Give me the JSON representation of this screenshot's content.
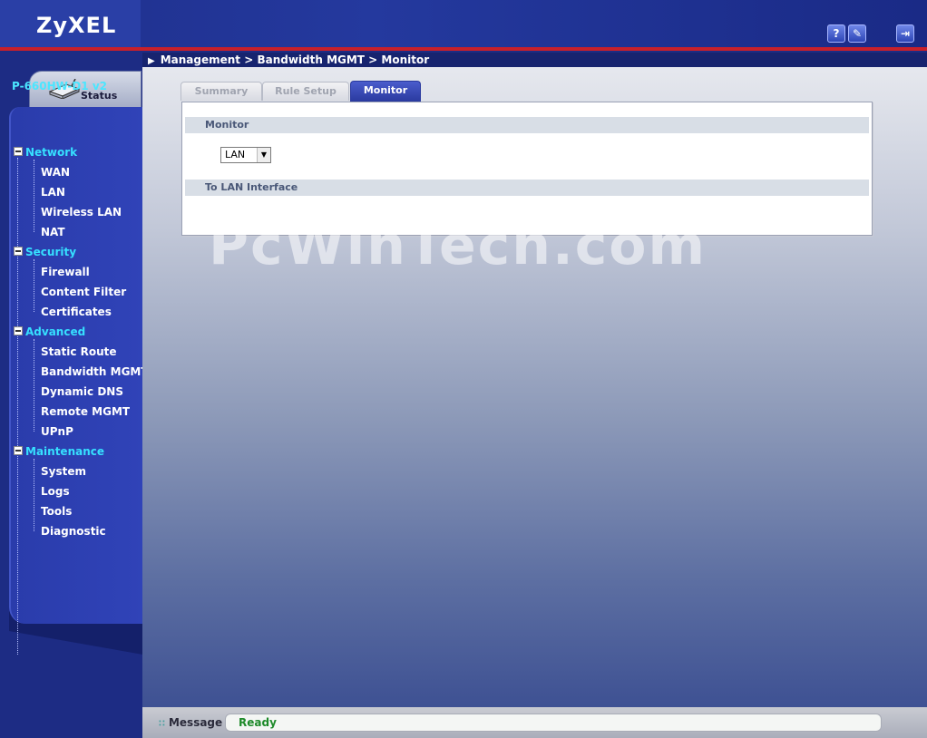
{
  "header": {
    "logo": "ZyXEL",
    "help_icon": "?",
    "wizard_icon": "✎",
    "logout_icon": "⇥"
  },
  "breadcrumb": "Management > Bandwidth MGMT > Monitor",
  "sidebar": {
    "status_label": "Status",
    "device_name": "P-660HW-D1 v2",
    "groups": [
      {
        "label": "Network",
        "items": [
          "WAN",
          "LAN",
          "Wireless LAN",
          "NAT"
        ]
      },
      {
        "label": "Security",
        "items": [
          "Firewall",
          "Content Filter",
          "Certificates"
        ]
      },
      {
        "label": "Advanced",
        "items": [
          "Static Route",
          "Bandwidth MGMT",
          "Dynamic DNS",
          "Remote MGMT",
          "UPnP"
        ]
      },
      {
        "label": "Maintenance",
        "items": [
          "System",
          "Logs",
          "Tools",
          "Diagnostic"
        ]
      }
    ]
  },
  "tabs": [
    {
      "label": "Summary",
      "active": false
    },
    {
      "label": "Rule Setup",
      "active": false
    },
    {
      "label": "Monitor",
      "active": true
    }
  ],
  "panel": {
    "section1": "Monitor",
    "select_value": "LAN",
    "section2": "To LAN Interface"
  },
  "watermark": "PcWinTech.com",
  "statusbar": {
    "label": "Message",
    "value": "Ready"
  },
  "colors": {
    "accent_red": "#c8202a",
    "nav_group_cyan": "#36e0ff",
    "active_tab": "#2a3a9f",
    "ready_green": "#1e8a2a"
  }
}
